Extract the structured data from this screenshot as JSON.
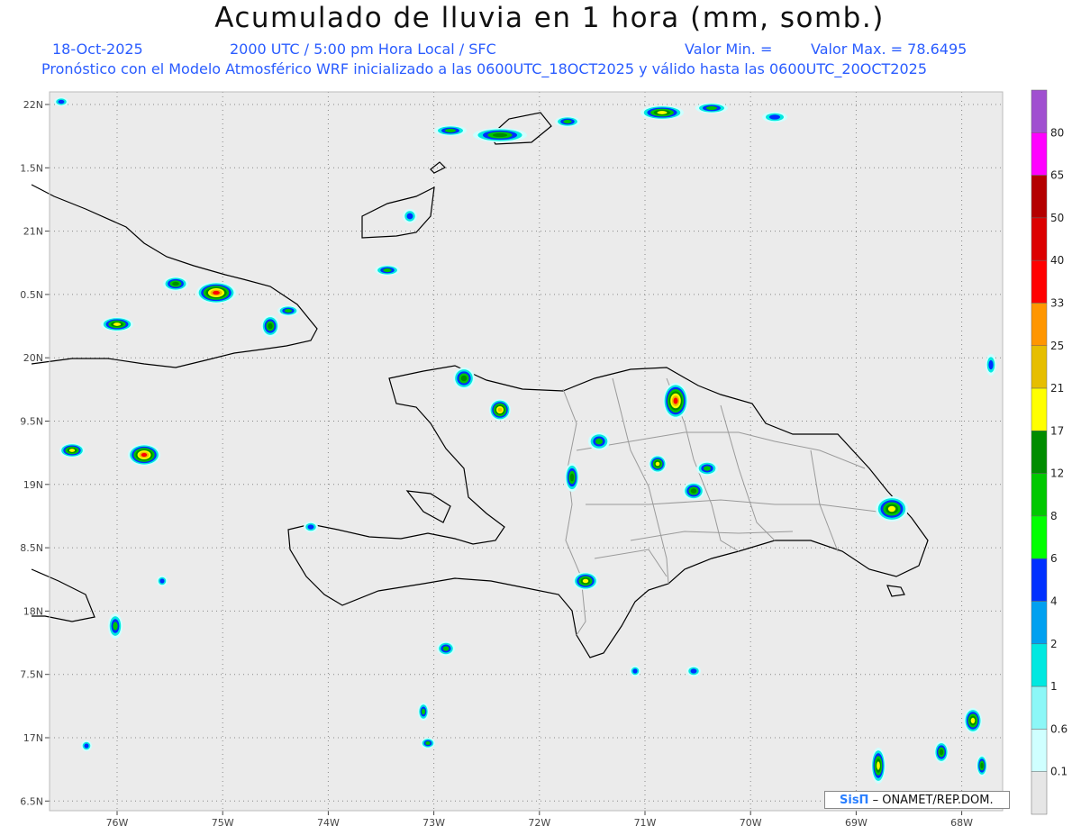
{
  "title": "Acumulado de lluvia en 1 hora (mm, somb.)",
  "date": "18-Oct-2025",
  "time_label": "2000 UTC / 5:00 pm Hora Local / SFC",
  "valor_min": "Valor Min. =",
  "valor_max": "Valor Max. = 78.6495",
  "model_info": "Pronóstico con el Modelo Atmosférico WRF inicializado a las 0600UTC_18OCT2025 y válido hasta las  0600UTC_20OCT2025",
  "credit": {
    "brand": "SisΠ",
    "text": "– ONAMET/REP.DOM."
  },
  "lat_labels": [
    "22N",
    "1.5N",
    "21N",
    "0.5N",
    "20N",
    "9.5N",
    "19N",
    "8.5N",
    "18N",
    "7.5N",
    "17N",
    "6.5N"
  ],
  "lon_labels": [
    "76W",
    "75W",
    "74W",
    "73W",
    "72W",
    "71W",
    "70W",
    "69W",
    "68W"
  ],
  "colorbar": {
    "labels": [
      "0.1",
      "0.6",
      "1",
      "2",
      "4",
      "6",
      "8",
      "12",
      "17",
      "21",
      "25",
      "33",
      "40",
      "50",
      "65",
      "80"
    ],
    "colors": [
      "#e6e6e6",
      "#cfffff",
      "#8cf7f7",
      "#00e8e0",
      "#00a0f0",
      "#0030ff",
      "#00ff00",
      "#00c800",
      "#008c00",
      "#ffff00",
      "#e6be00",
      "#ff9600",
      "#ff0000",
      "#dc0000",
      "#b40000",
      "#ff00ff",
      "#a050d0"
    ]
  },
  "colors": {
    "map_background": "#ebebeb",
    "coastline": "#000000",
    "provinces": "#9a9a9a",
    "subtitle": "#2a5cff"
  }
}
